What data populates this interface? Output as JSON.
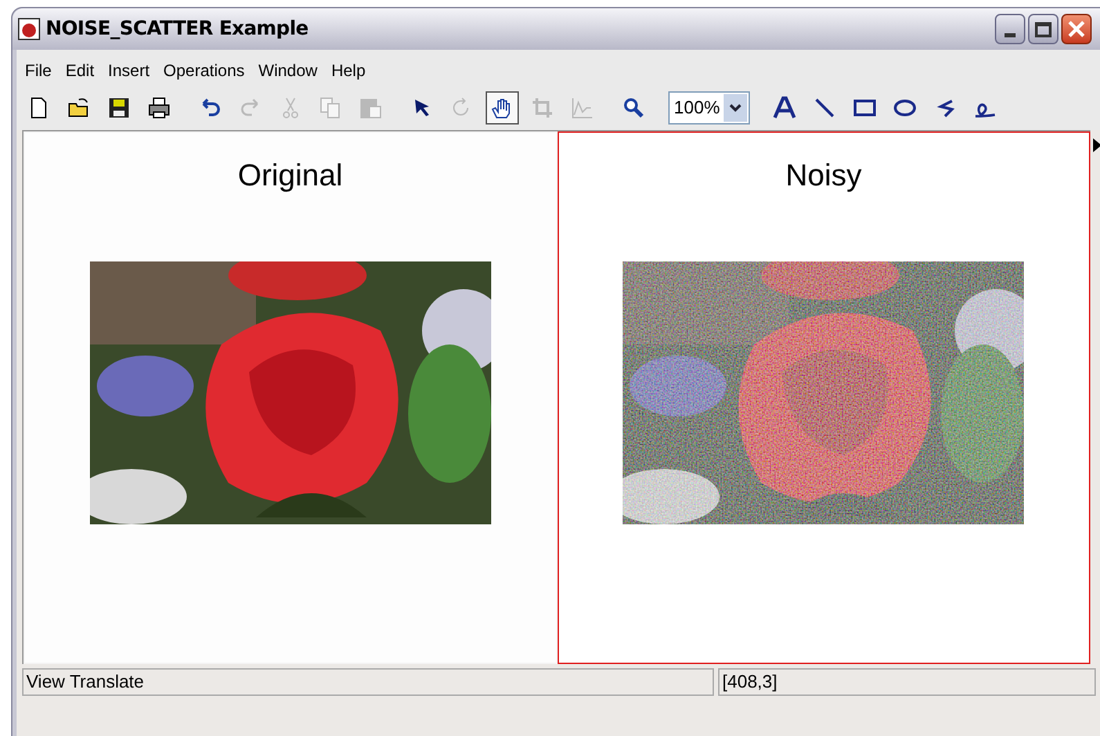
{
  "window": {
    "title": "NOISE_SCATTER Example"
  },
  "menu": [
    "File",
    "Edit",
    "Insert",
    "Operations",
    "Window",
    "Help"
  ],
  "toolbar": {
    "tools": [
      {
        "selected": false,
        "disabled": false
      },
      {
        "selected": false,
        "disabled": false
      },
      {
        "selected": false,
        "disabled": false
      },
      {
        "selected": false,
        "disabled": false
      },
      {
        "selected": false,
        "disabled": false
      },
      {
        "selected": false,
        "disabled": true
      },
      {
        "selected": false,
        "disabled": true
      },
      {
        "selected": false,
        "disabled": true
      },
      {
        "selected": false,
        "disabled": true
      },
      {
        "selected": false,
        "disabled": false
      },
      {
        "selected": false,
        "disabled": true
      },
      {
        "selected": true,
        "disabled": false
      },
      {
        "selected": false,
        "disabled": true
      },
      {
        "selected": false,
        "disabled": true
      },
      {
        "selected": false,
        "disabled": false
      }
    ],
    "zoom": "100%",
    "shapes": [
      {
        "selected": false
      },
      {
        "selected": false
      },
      {
        "selected": false
      },
      {
        "selected": false
      },
      {
        "selected": false
      },
      {
        "selected": false
      }
    ]
  },
  "panels": [
    {
      "title": "Original",
      "selected": false,
      "noisy": false
    },
    {
      "title": "Noisy",
      "selected": true,
      "noisy": true
    }
  ],
  "status_bar": {
    "message": "View Translate",
    "position": "[408,3]"
  }
}
